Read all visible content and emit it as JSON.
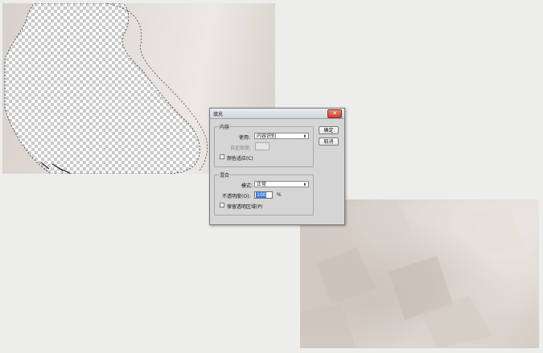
{
  "dialog": {
    "title": "填充",
    "close_glyph": "✕",
    "content_group": {
      "label": "内容",
      "use_label": "使用:",
      "use_value": "内容识别",
      "custom_pattern_label": "自定图案:",
      "color_adapt_label": "颜色适应(C)"
    },
    "blend_group": {
      "label": "混合",
      "mode_label": "模式:",
      "mode_value": "正常",
      "opacity_label": "不透明度(O):",
      "opacity_value": "100",
      "opacity_unit": "%",
      "preserve_transparency_label": "保留透明区域(P)"
    },
    "ok_label": "确定",
    "cancel_label": "取消"
  },
  "icons": {
    "dropdown_arrow": "⬍",
    "close": "close-icon",
    "dropdown": "chevron-updown-icon"
  },
  "colors": {
    "selection_highlight": "#3d7bd9",
    "close_button": "#c6412c",
    "canvas_tone": "#ddd6d0"
  }
}
